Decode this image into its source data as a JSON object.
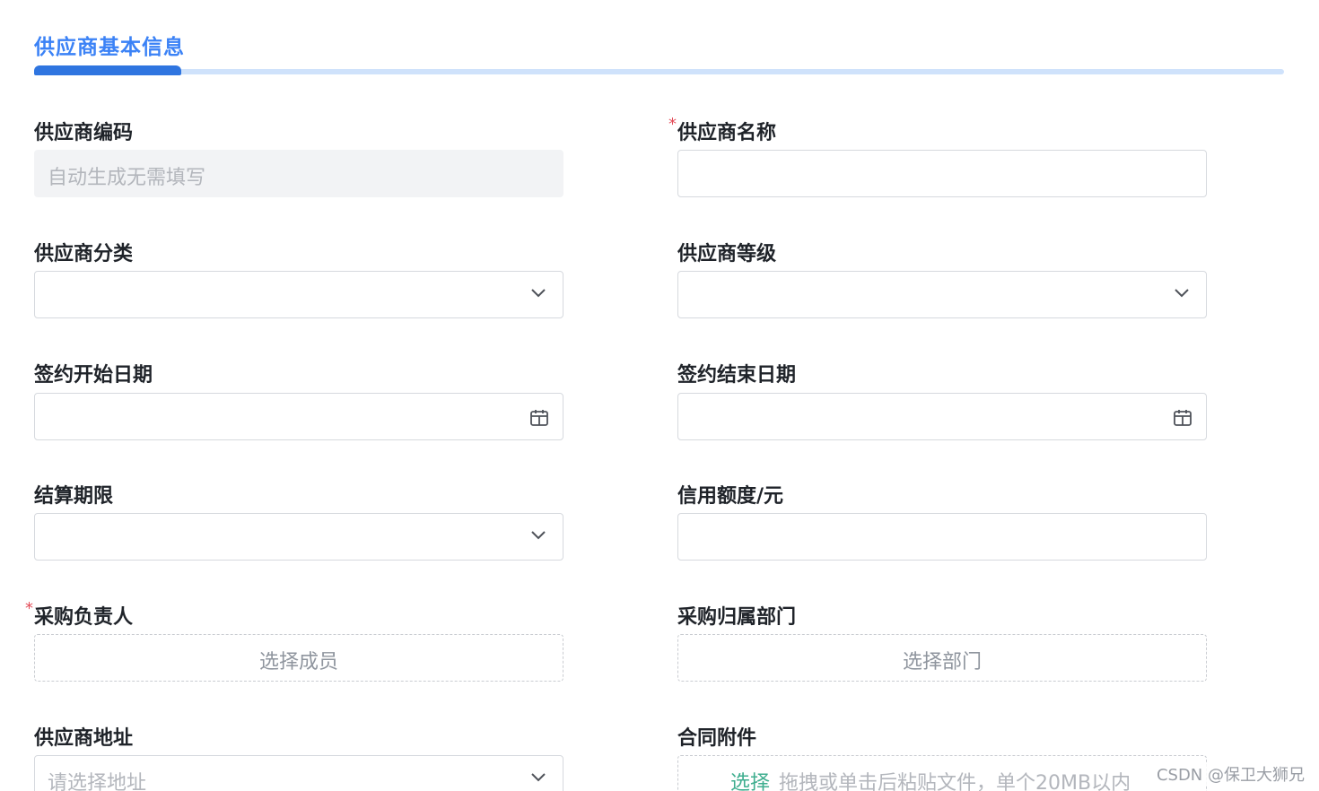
{
  "section": {
    "title": "供应商基本信息"
  },
  "fields": {
    "supplier_code": {
      "label": "供应商编码",
      "placeholder": "自动生成无需填写"
    },
    "supplier_name": {
      "label": "供应商名称",
      "required_mark": "*"
    },
    "supplier_category": {
      "label": "供应商分类"
    },
    "supplier_level": {
      "label": "供应商等级"
    },
    "contract_start_date": {
      "label": "签约开始日期"
    },
    "contract_end_date": {
      "label": "签约结束日期"
    },
    "settlement_period": {
      "label": "结算期限"
    },
    "credit_limit": {
      "label": "信用额度/元"
    },
    "purchase_owner": {
      "label": "采购负责人",
      "required_mark": "*",
      "button_text": "选择成员"
    },
    "purchase_department": {
      "label": "采购归属部门",
      "button_text": "选择部门"
    },
    "supplier_address": {
      "label": "供应商地址",
      "placeholder": "请选择地址"
    },
    "contract_attachment": {
      "label": "合同附件",
      "pick_text": "选择",
      "hint_text": "拖拽或单击后粘贴文件，单个20MB以内"
    }
  },
  "watermark": {
    "text": "CSDN @保卫大狮兄"
  },
  "colors": {
    "accent": "#2f75e0",
    "accent_light": "#cfe2fb",
    "required": "#e34d59",
    "upload_pick": "#3fae8f"
  }
}
